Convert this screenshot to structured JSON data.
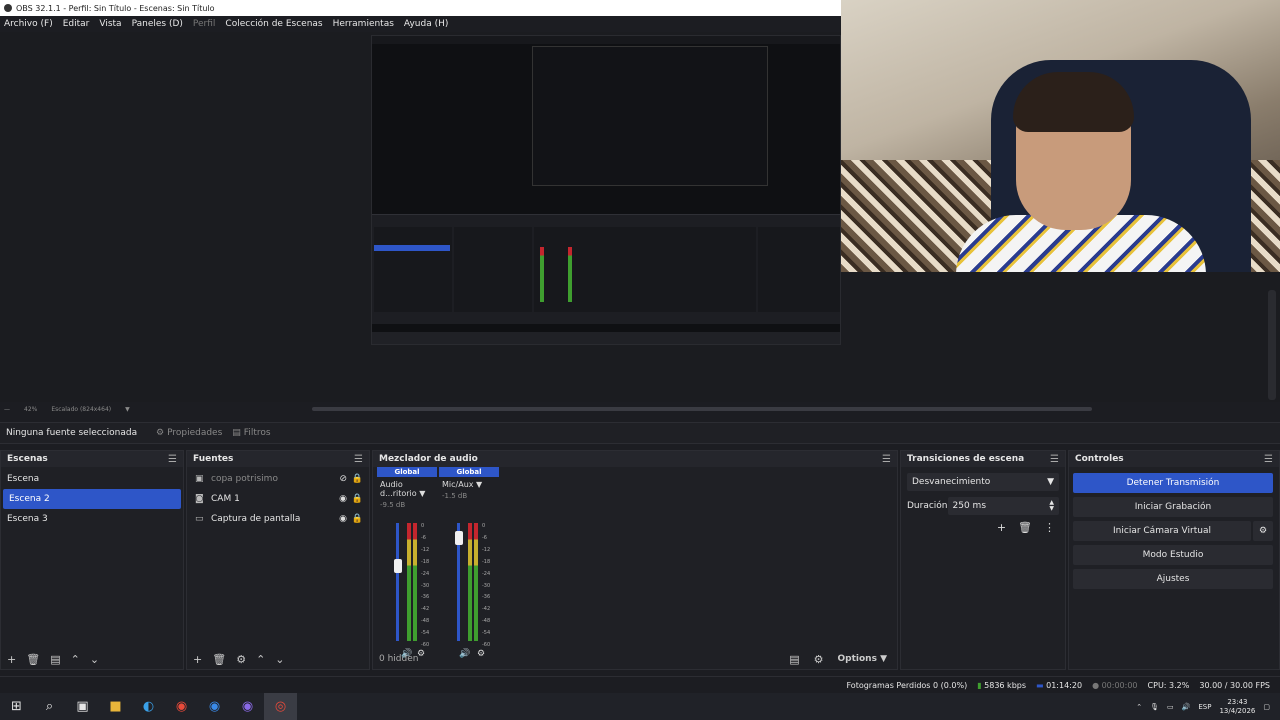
{
  "window": {
    "title": "OBS 32.1.1 - Perfil: Sin Título - Escenas: Sin Título"
  },
  "menu": [
    "Archivo (F)",
    "Editar",
    "Vista",
    "Paneles (D)",
    "Perfil",
    "Colección de Escenas",
    "Herramientas",
    "Ayuda (H)"
  ],
  "preview_bar": {
    "zoom": "42%",
    "scale_label": "Escalado (824x464)"
  },
  "properties_bar": {
    "no_source": "Ninguna fuente seleccionada",
    "properties": "Propiedades",
    "filters": "Filtros"
  },
  "scenes": {
    "title": "Escenas",
    "items": [
      "Escena",
      "Escena 2",
      "Escena 3"
    ],
    "selected_index": 1
  },
  "sources": {
    "title": "Fuentes",
    "items": [
      {
        "name": "copa potrisimo",
        "icon": "image-icon",
        "visible": false
      },
      {
        "name": "CAM 1",
        "icon": "camera-icon",
        "visible": true
      },
      {
        "name": "Captura de pantalla",
        "icon": "monitor-icon",
        "visible": true
      }
    ]
  },
  "mixer": {
    "title": "Mezclador de audio",
    "channels": [
      {
        "global": "Global",
        "name": "Audio d...ritorio",
        "db": "-9.5 dB"
      },
      {
        "global": "Global",
        "name": "Mic/Aux",
        "db": "-1.5 dB"
      }
    ],
    "scale": [
      "0",
      "-6",
      "-12",
      "-18",
      "-24",
      "-30",
      "-36",
      "-42",
      "-48",
      "-54",
      "-60"
    ],
    "hidden": "0 hidden",
    "options": "Options"
  },
  "transitions": {
    "title": "Transiciones de escena",
    "selected": "Desvanecimiento",
    "duration_label": "Duración",
    "duration_value": "250 ms"
  },
  "controls": {
    "title": "Controles",
    "stop_stream": "Detener Transmisión",
    "start_record": "Iniciar Grabación",
    "virtual_cam": "Iniciar Cámara Virtual",
    "studio_mode": "Modo Estudio",
    "settings": "Ajustes"
  },
  "status": {
    "dropped": "Fotogramas Perdidos 0 (0.0%)",
    "bitrate": "5836 kbps",
    "stream_time": "01:14:20",
    "rec_time": "00:00:00",
    "cpu": "CPU: 3.2%",
    "fps": "30.00 / 30.00 FPS"
  },
  "tray": {
    "lang": "ESP",
    "time": "23:43",
    "date": "13/4/2026"
  },
  "colors": {
    "accent": "#2e56c8",
    "bg": "#1f2025"
  }
}
